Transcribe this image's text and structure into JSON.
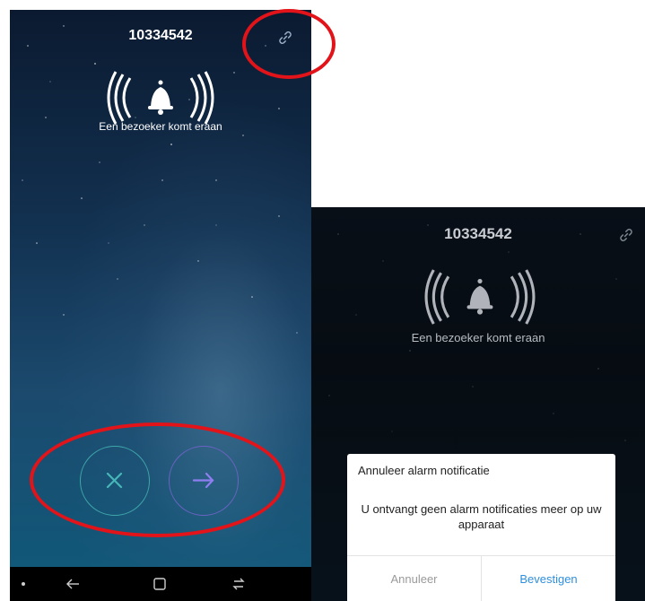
{
  "left_screen": {
    "title": "10334542",
    "subtitle": "Een bezoeker komt eraan",
    "icons": {
      "link": "link-icon",
      "bell": "bell-icon",
      "decline": "close-icon",
      "accept": "arrow-right-icon"
    },
    "navbar": [
      "dot-icon",
      "back-icon",
      "home-icon",
      "recents-icon"
    ]
  },
  "right_screen": {
    "title": "10334542",
    "subtitle": "Een bezoeker komt eraan",
    "dialog": {
      "title": "Annuleer alarm notificatie",
      "message": "U ontvangt geen alarm notificaties meer op uw apparaat",
      "cancel_label": "Annuleer",
      "confirm_label": "Bevestigen"
    }
  },
  "colors": {
    "annotation": "#e2141a",
    "decline_ring": "#3fa7a9",
    "accept_ring": "#6b63c2",
    "confirm_text": "#2f8fdd",
    "cancel_text": "#9a9a9a"
  }
}
